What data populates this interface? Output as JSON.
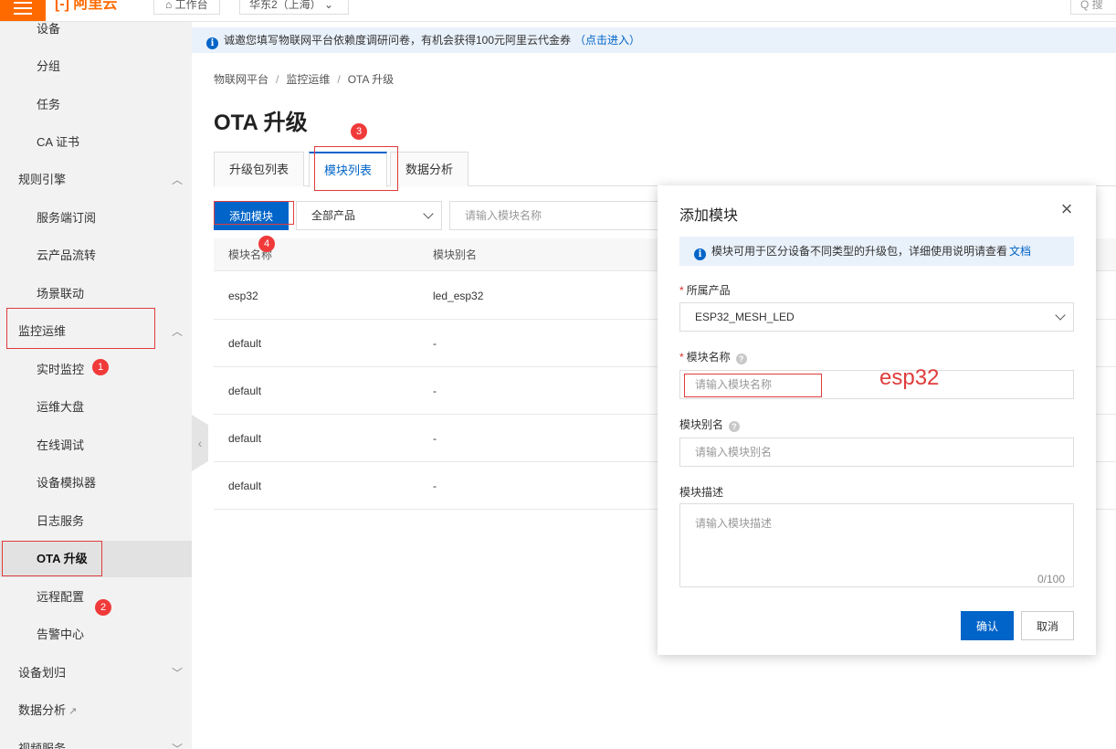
{
  "topbar": {
    "brand": "[-] 阿里云",
    "workbench": "⌂ 工作台",
    "region": "华东2（上海） ⌄",
    "search_hint": "Q 搜"
  },
  "sidebar": {
    "items": [
      {
        "label": "设备",
        "level": "sub"
      },
      {
        "label": "分组",
        "level": "sub"
      },
      {
        "label": "任务",
        "level": "sub"
      },
      {
        "label": "CA 证书",
        "level": "sub"
      },
      {
        "label": "规则引擎",
        "level": "group",
        "expanded": true
      },
      {
        "label": "服务端订阅",
        "level": "sub"
      },
      {
        "label": "云产品流转",
        "level": "sub"
      },
      {
        "label": "场景联动",
        "level": "sub"
      },
      {
        "label": "监控运维",
        "level": "group",
        "expanded": true
      },
      {
        "label": "实时监控",
        "level": "sub"
      },
      {
        "label": "运维大盘",
        "level": "sub"
      },
      {
        "label": "在线调试",
        "level": "sub"
      },
      {
        "label": "设备模拟器",
        "level": "sub"
      },
      {
        "label": "日志服务",
        "level": "sub"
      },
      {
        "label": "OTA 升级",
        "level": "sub",
        "active": true
      },
      {
        "label": "远程配置",
        "level": "sub"
      },
      {
        "label": "告警中心",
        "level": "sub"
      },
      {
        "label": "设备划归",
        "level": "group",
        "expanded": false
      },
      {
        "label": "数据分析",
        "level": "group",
        "external": true
      },
      {
        "label": "视频服务",
        "level": "group",
        "expanded": false
      }
    ]
  },
  "notice": {
    "text": "诚邀您填写物联网平台依赖度调研问卷，有机会获得100元阿里云代金券",
    "link": "（点击进入）"
  },
  "breadcrumb": [
    "物联网平台",
    "监控运维",
    "OTA 升级"
  ],
  "page_title": "OTA 升级",
  "tabs": [
    {
      "label": "升级包列表",
      "active": false
    },
    {
      "label": "模块列表",
      "active": true
    },
    {
      "label": "数据分析",
      "active": false
    }
  ],
  "toolbar": {
    "add_button": "添加模块",
    "product_filter": "全部产品",
    "name_search_placeholder": "请输入模块名称"
  },
  "table": {
    "columns": [
      "模块名称",
      "模块别名"
    ],
    "rows": [
      [
        "esp32",
        "led_esp32"
      ],
      [
        "default",
        "-"
      ],
      [
        "default",
        "-"
      ],
      [
        "default",
        "-"
      ],
      [
        "default",
        "-"
      ]
    ]
  },
  "dialog": {
    "title": "添加模块",
    "tip": "模块可用于区分设备不同类型的升级包，详细使用说明请查看",
    "tip_link": "文档",
    "product_label": "所属产品",
    "product_value": "ESP32_MESH_LED",
    "name_label": "模块名称",
    "name_placeholder": "请输入模块名称",
    "alias_label": "模块别名",
    "alias_placeholder": "请输入模块别名",
    "desc_label": "模块描述",
    "desc_placeholder": "请输入模块描述",
    "desc_counter": "0/100",
    "confirm": "确认",
    "cancel": "取消"
  },
  "annotations": {
    "numbers": [
      "1",
      "2",
      "3",
      "4"
    ],
    "handwritten": "esp32",
    "color": "#e03c3c"
  },
  "colors": {
    "primary": "#0064c8",
    "brand": "#ff6a00",
    "sidebar_bg": "#f2f2f2"
  }
}
